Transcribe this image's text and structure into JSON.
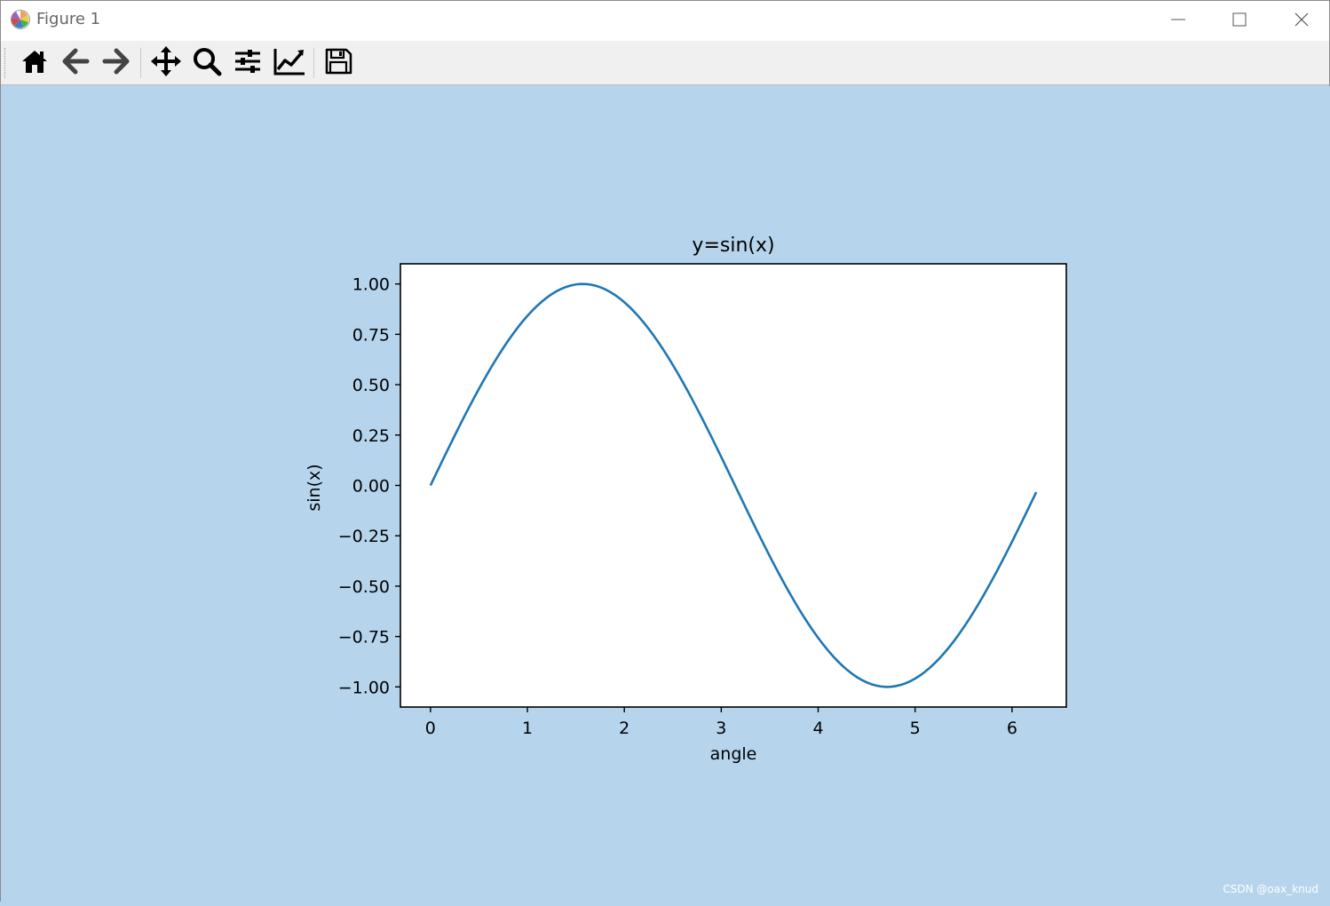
{
  "window": {
    "title": "Figure 1",
    "icons": {
      "app": "matplotlib-logo-icon",
      "minimize": "minimize-icon",
      "maximize": "maximize-icon",
      "close": "close-icon"
    }
  },
  "toolbar": {
    "buttons": [
      {
        "icon": "home-icon",
        "tooltip": "Reset original view"
      },
      {
        "icon": "back-arrow-icon",
        "tooltip": "Back to previous view"
      },
      {
        "icon": "forward-arrow-icon",
        "tooltip": "Forward to next view"
      },
      {
        "icon": "pan-move-icon",
        "tooltip": "Pan axes"
      },
      {
        "icon": "zoom-magnifier-icon",
        "tooltip": "Zoom to rectangle"
      },
      {
        "icon": "subplots-sliders-icon",
        "tooltip": "Configure subplots"
      },
      {
        "icon": "edit-axis-chart-icon",
        "tooltip": "Edit axis"
      },
      {
        "icon": "save-floppy-icon",
        "tooltip": "Save the figure"
      }
    ]
  },
  "colors": {
    "figure_background": "#b6d5ed",
    "axes_background": "#ffffff",
    "line": "#1f77b4",
    "toolbar": "#f0f0f0"
  },
  "chart_data": {
    "type": "line",
    "title": "y=sin(x)",
    "xlabel": "angle",
    "ylabel": "sin(x)",
    "function": "sin",
    "x_start": 0,
    "x_end": 6.25,
    "x_step": 0.05,
    "xlim": [
      -0.31,
      6.56
    ],
    "ylim": [
      -1.1,
      1.1
    ],
    "xticks": [
      0,
      1,
      2,
      3,
      4,
      5,
      6
    ],
    "xtick_labels": [
      "0",
      "1",
      "2",
      "3",
      "4",
      "5",
      "6"
    ],
    "yticks": [
      1.0,
      0.75,
      0.5,
      0.25,
      0.0,
      -0.25,
      -0.5,
      -0.75,
      -1.0
    ],
    "ytick_labels": [
      "1.00",
      "0.75",
      "0.50",
      "0.25",
      "0.00",
      "−0.25",
      "−0.50",
      "−0.75",
      "−1.00"
    ],
    "grid": false,
    "series": [
      {
        "color": "#1f77b4"
      }
    ]
  },
  "watermark": "CSDN @oax_knud"
}
